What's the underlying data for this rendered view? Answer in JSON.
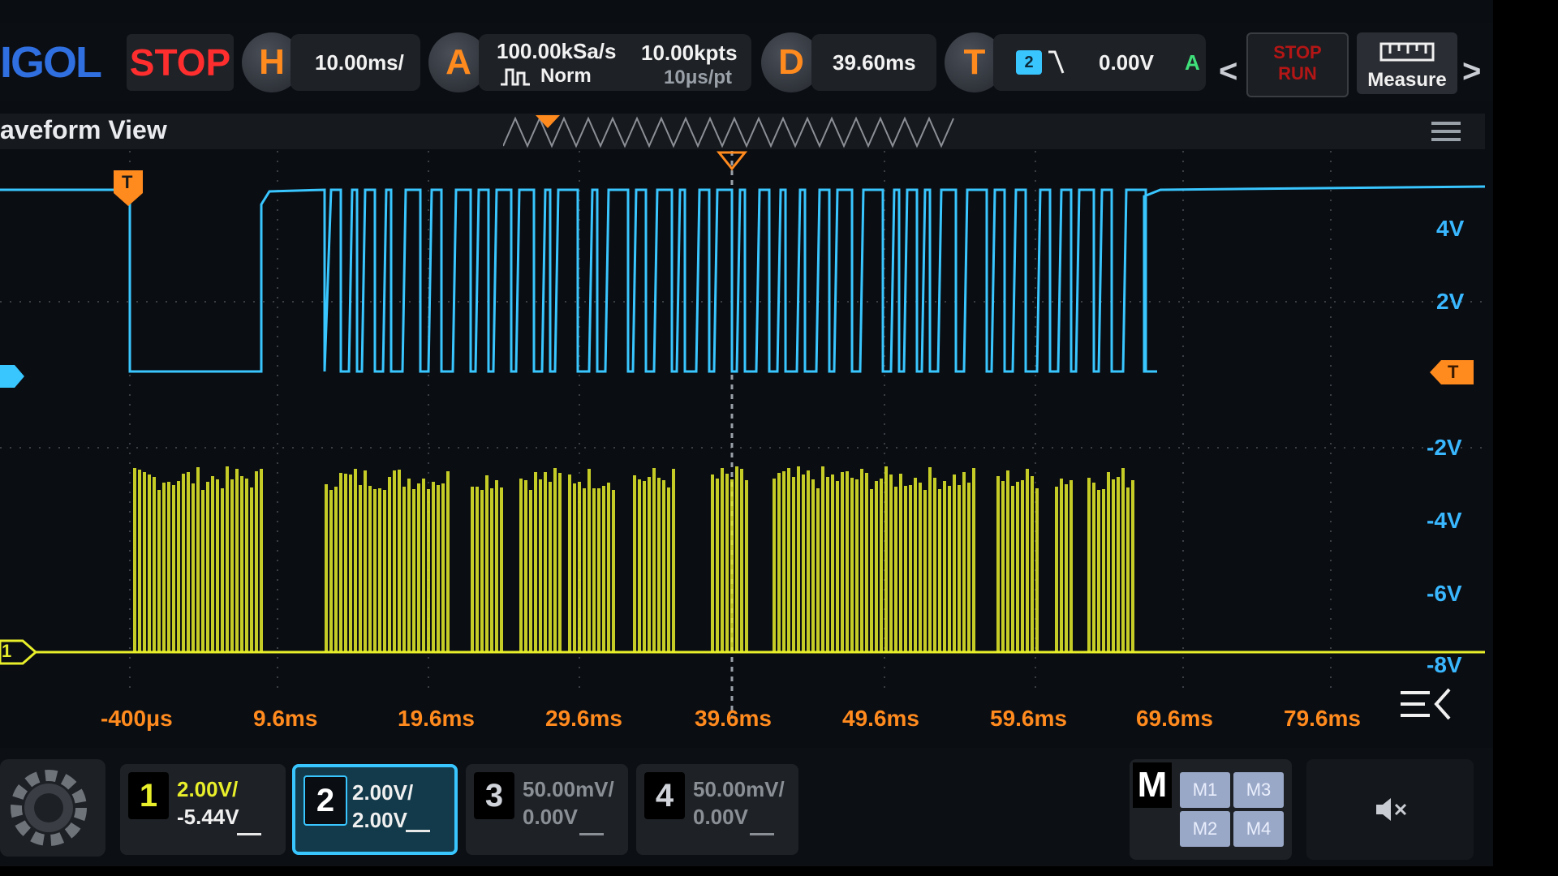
{
  "app": {
    "logo": "IGOL",
    "run_state": "STOP"
  },
  "horizontal": {
    "label": "H",
    "timebase": "10.00ms/"
  },
  "acquire": {
    "label": "A",
    "sample_rate": "100.00kSa/s",
    "mode": "Norm",
    "memory_depth": "10.00kpts",
    "time_per_point": "10μs/pt"
  },
  "delay": {
    "label": "D",
    "value": "39.60ms"
  },
  "trigger": {
    "label": "T",
    "source": "2",
    "level": "0.00V",
    "mode": "A"
  },
  "toolbar": {
    "prev_label": "<",
    "next_label": ">",
    "stop_run_line1": "STOP",
    "stop_run_line2": "RUN",
    "measure_label": "Measure"
  },
  "waveform_view": {
    "title": "aveform View",
    "y_labels": [
      "4V",
      "2V",
      "-2V",
      "-4V",
      "-6V",
      "-8V"
    ],
    "x_labels": [
      "-400μs",
      "9.6ms",
      "19.6ms",
      "29.6ms",
      "39.6ms",
      "49.6ms",
      "59.6ms",
      "69.6ms",
      "79.6ms"
    ],
    "trigger_marker": "T",
    "ch1_marker": "1",
    "trigger_level_marker": "T"
  },
  "channels": [
    {
      "number": "1",
      "scale": "2.00V/",
      "offset": "-5.44V",
      "color": "#e8ef2a",
      "active": false
    },
    {
      "number": "2",
      "scale": "2.00V/",
      "offset": "2.00V",
      "color": "#39c6ff",
      "active": true
    },
    {
      "number": "3",
      "scale": "50.00mV/",
      "offset": "0.00V",
      "color": "#8a8f96",
      "active": false
    },
    {
      "number": "4",
      "scale": "50.00mV/",
      "offset": "0.00V",
      "color": "#8a8f96",
      "active": false
    }
  ],
  "math": {
    "label": "M",
    "buttons": [
      "M1",
      "M3",
      "M2",
      "M4"
    ]
  },
  "colors": {
    "ch1": "#e8ef2a",
    "ch2": "#39c6ff",
    "accent": "#ff8a1e",
    "stop": "#ff2e2e"
  }
}
